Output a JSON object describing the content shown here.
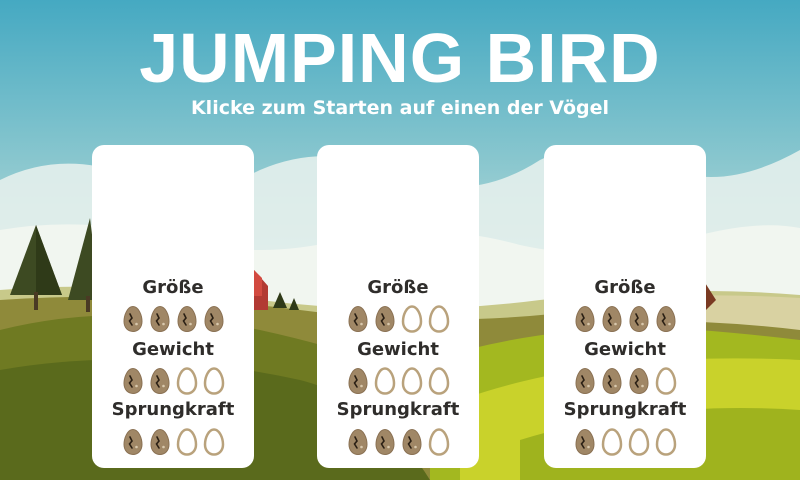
{
  "game": {
    "title": "JUMPING BIRD",
    "subtitle": "Klicke zum Starten auf einen der Vögel"
  },
  "stat_labels": {
    "size": "Größe",
    "weight": "Gewicht",
    "jump": "Sprungkraft"
  },
  "max_rating": 4,
  "birds": [
    {
      "size": 4,
      "weight": 2,
      "jump": 2
    },
    {
      "size": 2,
      "weight": 1,
      "jump": 3
    },
    {
      "size": 4,
      "weight": 3,
      "jump": 1
    }
  ],
  "colors": {
    "sky_top": "#4aaec4",
    "sky_bottom": "#d8ece6",
    "egg_filled": "#a08766",
    "egg_outline": "#b9a27c",
    "text_dark": "#2f2d2b"
  },
  "icons": {
    "egg_filled": "egg-filled-icon",
    "egg_empty": "egg-empty-icon"
  }
}
